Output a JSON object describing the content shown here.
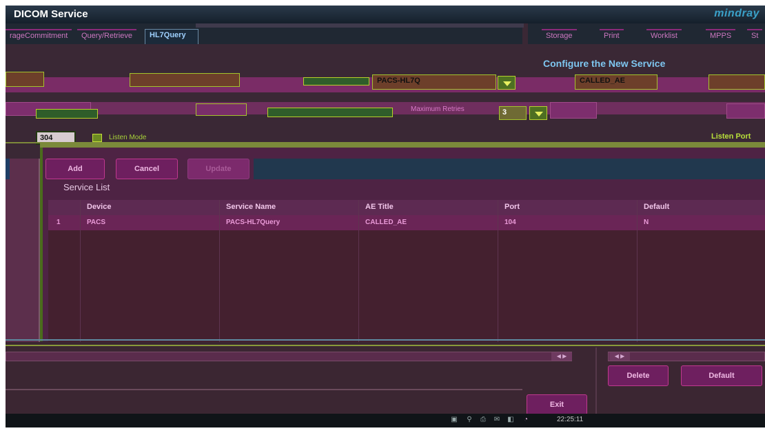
{
  "window": {
    "title": "DICOM Service",
    "brand": "mindray"
  },
  "tabs_left": [
    {
      "label": "rageCommitment"
    },
    {
      "label": "Query/Retrieve"
    },
    {
      "label": "HL7Query"
    }
  ],
  "tabs_right": [
    {
      "label": "Storage"
    },
    {
      "label": "Print"
    },
    {
      "label": "Worklist"
    },
    {
      "label": "MPPS"
    },
    {
      "label": "St"
    }
  ],
  "configure_title": "Configure the New Service",
  "form": {
    "service_name_value": "PACS-HL7Q",
    "ae_title_value": "CALLED_AE",
    "port_value": "304",
    "max_retries_label": "Maximum Retries",
    "max_retries_value": "3",
    "listen_mode_label": "Listen Mode",
    "listen_port_label": "Listen Port"
  },
  "buttons": {
    "add": "Add",
    "cancel": "Cancel",
    "update": "Update",
    "delete": "Delete",
    "default": "Default",
    "exit": "Exit"
  },
  "service_list": {
    "label": "Service List",
    "columns": [
      "Device",
      "Service Name",
      "AE Title",
      "Port",
      "Default"
    ],
    "rows": [
      {
        "index": "1",
        "device": "PACS",
        "service_name": "PACS-HL7Query",
        "ae_title": "CALLED_AE",
        "port": "104",
        "default": "N"
      }
    ]
  },
  "taskbar": {
    "time": "22:25:11"
  }
}
